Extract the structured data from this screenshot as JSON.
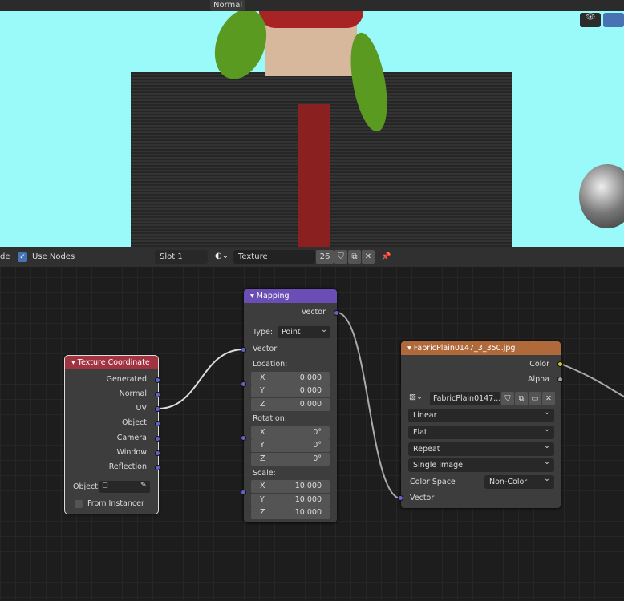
{
  "viewport": {
    "shading_mode": "Normal"
  },
  "header": {
    "mode_partial": "de",
    "use_nodes_label": "Use Nodes",
    "slot": "Slot 1",
    "material_name": "Texture",
    "user_count": "26"
  },
  "nodes": {
    "texture_coordinate": {
      "title": "Texture Coordinate",
      "outputs": [
        "Generated",
        "Normal",
        "UV",
        "Object",
        "Camera",
        "Window",
        "Reflection"
      ],
      "object_label": "Object:",
      "from_instancer": "From Instancer"
    },
    "mapping": {
      "title": "Mapping",
      "output": "Vector",
      "type_label": "Type:",
      "type_value": "Point",
      "input": "Vector",
      "location_label": "Location:",
      "location": [
        {
          "axis": "X",
          "value": "0.000"
        },
        {
          "axis": "Y",
          "value": "0.000"
        },
        {
          "axis": "Z",
          "value": "0.000"
        }
      ],
      "rotation_label": "Rotation:",
      "rotation": [
        {
          "axis": "X",
          "value": "0°"
        },
        {
          "axis": "Y",
          "value": "0°"
        },
        {
          "axis": "Z",
          "value": "0°"
        }
      ],
      "scale_label": "Scale:",
      "scale": [
        {
          "axis": "X",
          "value": "10.000"
        },
        {
          "axis": "Y",
          "value": "10.000"
        },
        {
          "axis": "Z",
          "value": "10.000"
        }
      ]
    },
    "image_texture": {
      "title": "FabricPlain0147_3_350.jpg",
      "outputs": [
        "Color",
        "Alpha"
      ],
      "image_name": "FabricPlain0147...",
      "interpolation": "Linear",
      "projection": "Flat",
      "extension": "Repeat",
      "source": "Single Image",
      "color_space_label": "Color Space",
      "color_space": "Non-Color",
      "input": "Vector"
    }
  },
  "colors": {
    "tex_coord_header": "#a23340",
    "mapping_header": "#6a4eb5",
    "image_header": "#b0693a",
    "sky": "#9af9f9"
  }
}
